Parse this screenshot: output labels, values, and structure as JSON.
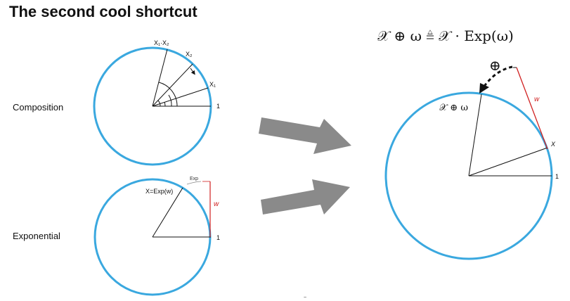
{
  "title": "The second cool shortcut",
  "labels": {
    "composition": "Composition",
    "exponential": "Exponential"
  },
  "composition_circle": {
    "x1x2": "X₁·X₂",
    "x2": "X₂",
    "x1": "X₁",
    "one": "1"
  },
  "exponential_circle": {
    "x_exp": "X=Exp(w)",
    "exp_tag": "Exp",
    "w": "w",
    "one": "1"
  },
  "right_circle": {
    "equation": "𝒳 ⊕ ω ≜ 𝒳 · Exp(ω)",
    "oplus": "⊕",
    "x_oplus_w": "𝒳 ⊕ ω",
    "w": "w",
    "x": "X",
    "one": "1"
  },
  "footer_glyph": "~",
  "colors": {
    "circle": "#3aa8df",
    "arrow": "#8a8a8a",
    "tangent": "#d02020"
  }
}
